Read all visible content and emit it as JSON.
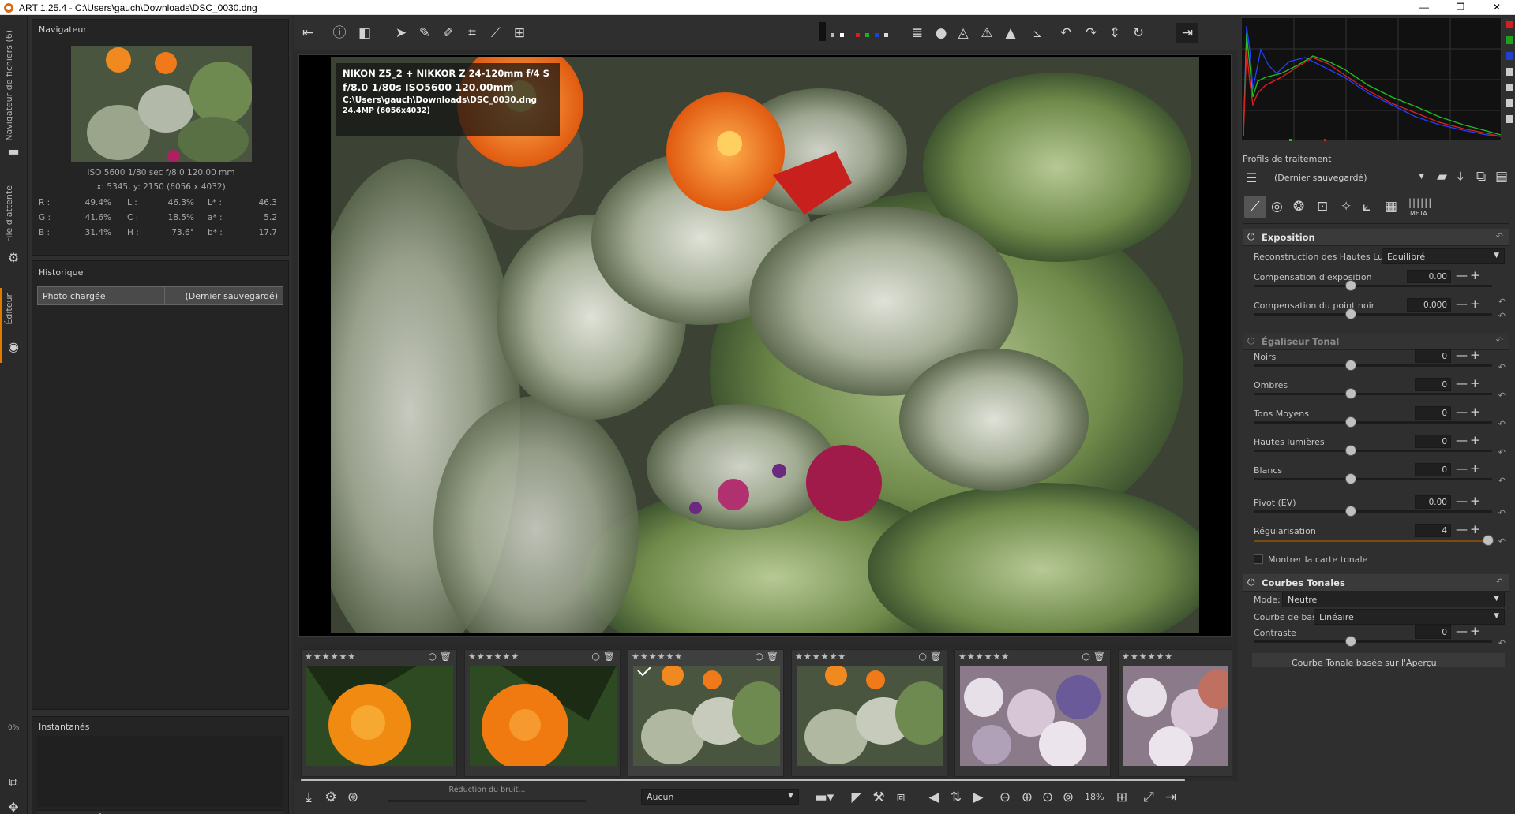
{
  "window": {
    "title": "ART 1.25.4 - C:\\Users\\gauch\\Downloads\\DSC_0030.dng",
    "minimize": "—",
    "maximize": "❐",
    "close": "✕"
  },
  "sidebar_tabs": {
    "file_browser": "Navigateur de fichiers (6)",
    "queue": "File d'attente",
    "editor": "Éditeur",
    "progress": "0%"
  },
  "navigator": {
    "title": "Navigateur",
    "exif_line": "ISO 5600    1/80 sec    f/8.0    120.00 mm",
    "coords_line": "x: 5345, y: 2150    (6056 x 4032)",
    "rows": [
      {
        "a": "R :",
        "av": "49.4%",
        "b": "L :",
        "bv": "46.3%",
        "c": "L* :",
        "cv": "46.3"
      },
      {
        "a": "G :",
        "av": "41.6%",
        "b": "C :",
        "bv": "18.5%",
        "c": "a* :",
        "cv": "5.2"
      },
      {
        "a": "B :",
        "av": "31.4%",
        "b": "H :",
        "bv": "73.6°",
        "c": "b* :",
        "cv": "17.7"
      }
    ]
  },
  "history": {
    "title": "Historique",
    "row_label": "Photo chargée",
    "row_value": "(Dernier sauvegardé)"
  },
  "snapshots": {
    "title": "Instantanés",
    "add": "+",
    "remove": "−"
  },
  "overlay": {
    "camera": "NIKON Z5_2 + NIKKOR Z 24-120mm f/4 S",
    "exposure": "f/8.0  1/80s  ISO5600  120.00mm",
    "path": "C:\\Users\\gauch\\Downloads\\DSC_0030.dng",
    "size": "24.4MP (6056x4032)"
  },
  "filmstrip": {
    "stars": "★★★★★★",
    "count": 6
  },
  "bottombar": {
    "status": "Réduction du bruit...",
    "filter": "Aucun",
    "zoom": "18%"
  },
  "profiles": {
    "title": "Profils de traitement",
    "value": "(Dernier sauvegardé)"
  },
  "tool_tabs": {
    "meta": "META"
  },
  "exposure": {
    "title": "Exposition",
    "highlight_label": "Reconstruction des Hautes Lumières:",
    "highlight_value": "Equilibré",
    "comp_label": "Compensation d'exposition",
    "comp_value": "0.00",
    "black_label": "Compensation du point noir",
    "black_value": "0.000"
  },
  "tone_eq": {
    "title": "Égaliseur Tonal",
    "rows": [
      {
        "label": "Noirs",
        "value": "0"
      },
      {
        "label": "Ombres",
        "value": "0"
      },
      {
        "label": "Tons Moyens",
        "value": "0"
      },
      {
        "label": "Hautes lumières",
        "value": "0"
      },
      {
        "label": "Blancs",
        "value": "0"
      },
      {
        "label": "Pivot (EV)",
        "value": "0.00"
      },
      {
        "label": "Régularisation",
        "value": "4"
      }
    ],
    "show_map": "Montrer la carte tonale"
  },
  "curves": {
    "title": "Courbes Tonales",
    "mode_label": "Mode:",
    "mode_value": "Neutre",
    "base_label": "Courbe de base:",
    "base_value": "Linéaire",
    "contrast_label": "Contraste",
    "contrast_value": "0",
    "more": "Courbe Tonale basée sur l'Aperçu"
  },
  "colors": {
    "accent": "#e07b00",
    "panel": "#2f2f2f",
    "dark": "#242424"
  }
}
